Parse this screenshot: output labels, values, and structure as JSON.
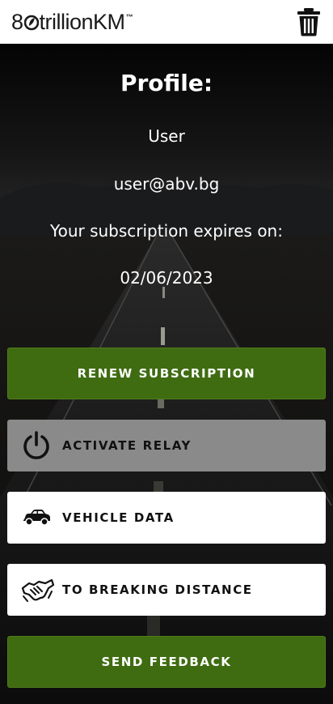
{
  "header": {
    "logo_prefix": "8",
    "logo_text": "trillionKM",
    "logo_tm": "™",
    "delete_icon": "trash-icon"
  },
  "profile": {
    "title": "Profile:",
    "username": "User",
    "email": "user@abv.bg",
    "subscription_label": "Your subscription expires on:",
    "subscription_date": "02/06/2023"
  },
  "buttons": {
    "renew": "RENEW SUBSCRIPTION",
    "activate_relay": "ACTIVATE RELAY",
    "vehicle_data": "VEHICLE DATA",
    "breaking_distance": "TO BREAKING DISTANCE",
    "feedback": "SEND FEEDBACK"
  },
  "colors": {
    "green": "#3f6c11",
    "gray": "#8a8a8a",
    "white": "#ffffff"
  }
}
